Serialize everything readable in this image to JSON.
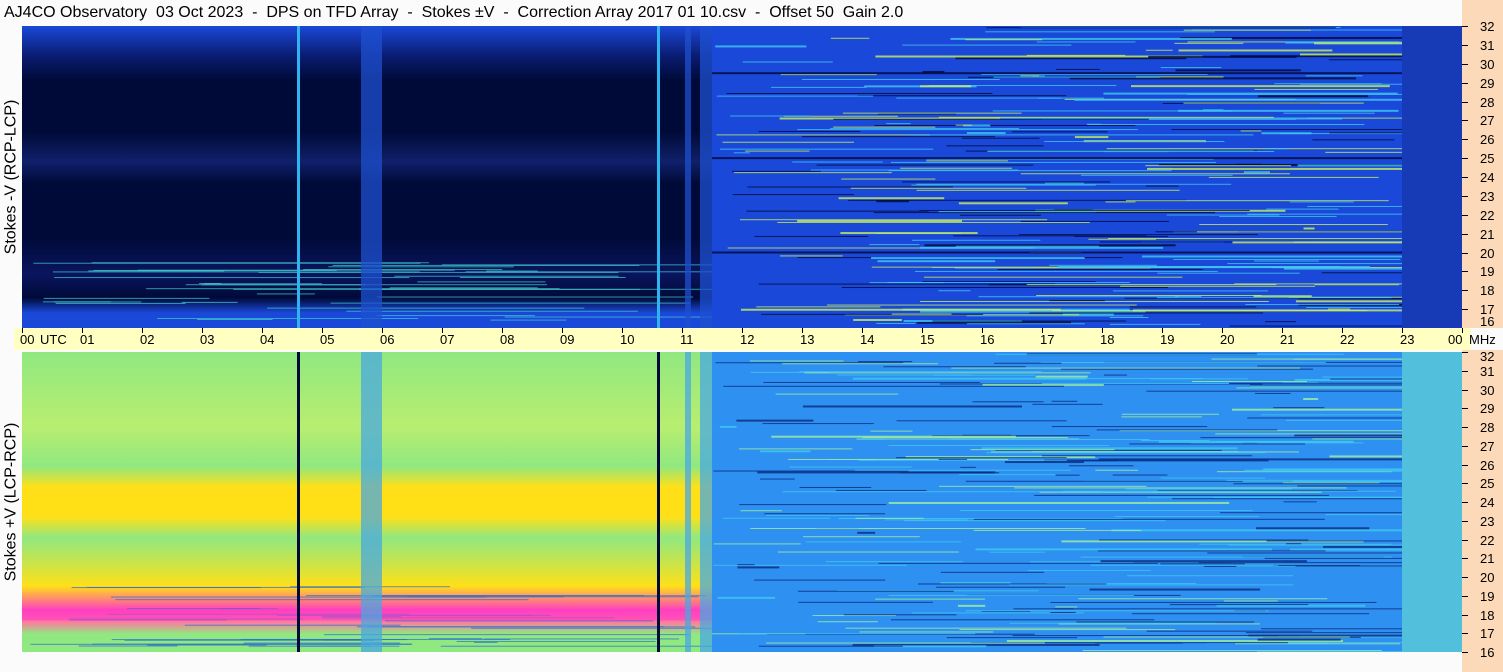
{
  "title": "AJ4CO Observatory  03 Oct 2023  -  DPS on TFD Array  -  Stokes ±V  -  Correction Array 2017 01 10.csv  -  Offset 50  Gain 2.0",
  "panels": {
    "top_label": "Stokes -V (RCP-LCP)",
    "bottom_label": "Stokes +V (LCP-RCP)"
  },
  "colors": {
    "minus_v_low": "#000a38",
    "minus_v_mid": "#1a48d8",
    "minus_v_high": "#30b4f0",
    "plus_v_low": "#2e90f0",
    "plus_v_mid": "#90e880",
    "plus_v_high": "#ffe018",
    "plus_v_peak": "#ff40c0",
    "freq_axis_bg": "#fcd9b8",
    "time_axis_bg": "#ffffc2"
  },
  "chart_data": [
    {
      "type": "heatmap",
      "title": "Stokes -V (RCP-LCP)",
      "xlabel": "UTC",
      "ylabel": "MHz",
      "x_ticks": [
        "00",
        "01",
        "02",
        "03",
        "04",
        "05",
        "06",
        "07",
        "08",
        "09",
        "10",
        "11",
        "12",
        "13",
        "14",
        "15",
        "16",
        "17",
        "18",
        "19",
        "20",
        "21",
        "22",
        "23",
        "00"
      ],
      "y_ticks": [
        "32",
        "31",
        "30",
        "29",
        "28",
        "27",
        "26",
        "25",
        "24",
        "23",
        "22",
        "21",
        "20",
        "19",
        "18",
        "17",
        "16"
      ],
      "xlim": [
        0,
        24
      ],
      "ylim": [
        16,
        32
      ],
      "night_window_utc": [
        0,
        11.5
      ],
      "day_window_utc": [
        11.5,
        23
      ],
      "broadband_lines_utc": [
        4.6,
        10.6
      ],
      "broadband_blocks_utc": [
        [
          5.65,
          6.0
        ],
        [
          11.05,
          11.15
        ],
        [
          11.3,
          11.5
        ]
      ],
      "dark_freq_bands_mhz": [
        29.5,
        25.0,
        20.0
      ]
    },
    {
      "type": "heatmap",
      "title": "Stokes +V (LCP-RCP)",
      "xlabel": "UTC",
      "ylabel": "MHz",
      "x_ticks": [
        "00",
        "01",
        "02",
        "03",
        "04",
        "05",
        "06",
        "07",
        "08",
        "09",
        "10",
        "11",
        "12",
        "13",
        "14",
        "15",
        "16",
        "17",
        "18",
        "19",
        "20",
        "21",
        "22",
        "23",
        "00"
      ],
      "y_ticks": [
        "32",
        "31",
        "30",
        "29",
        "28",
        "27",
        "26",
        "25",
        "24",
        "23",
        "22",
        "21",
        "20",
        "19",
        "18",
        "17",
        "16"
      ],
      "xlim": [
        0,
        24
      ],
      "ylim": [
        16,
        32
      ],
      "night_window_utc": [
        0,
        11.5
      ],
      "day_window_utc": [
        11.5,
        23
      ],
      "broadband_lines_utc": [
        4.6,
        10.6
      ],
      "broadband_blocks_utc": [
        [
          5.65,
          6.0
        ],
        [
          11.05,
          11.15
        ],
        [
          11.3,
          11.5
        ]
      ],
      "bright_freq_bands_mhz": [
        24.0,
        18.0
      ]
    }
  ]
}
